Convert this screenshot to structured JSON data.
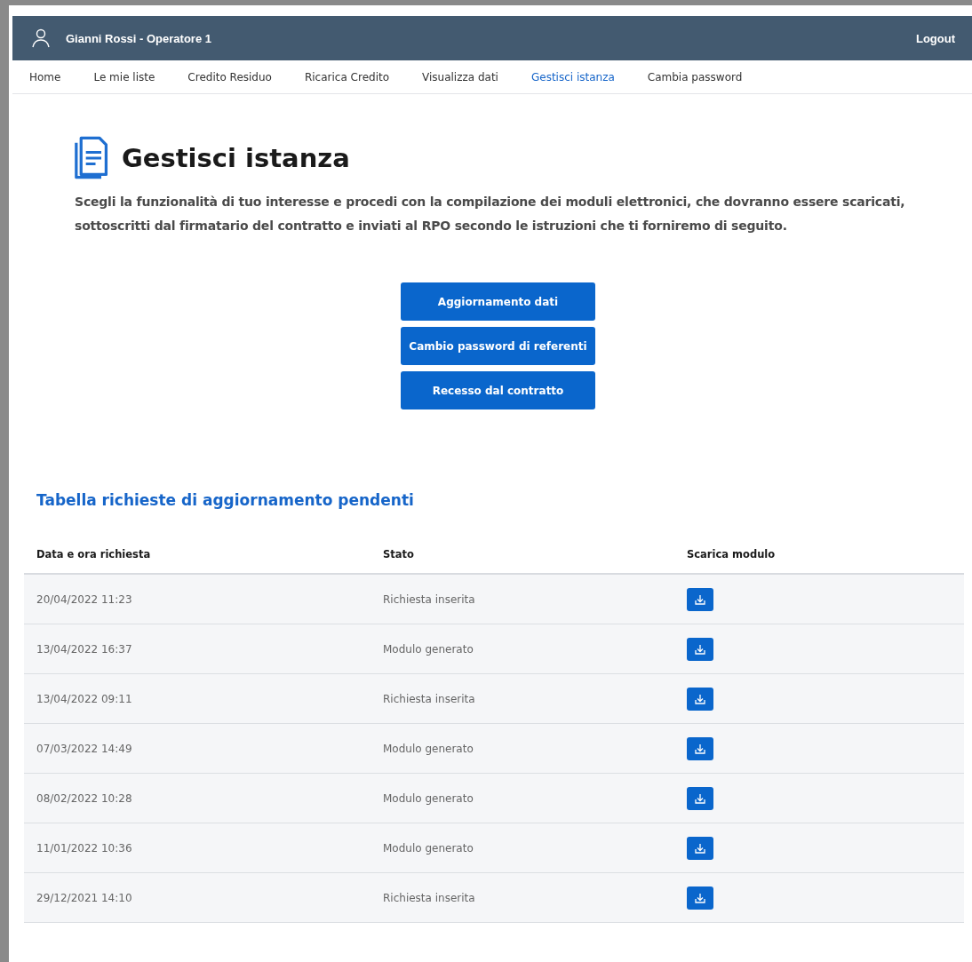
{
  "header": {
    "user": "Gianni Rossi - Operatore 1",
    "logout": "Logout"
  },
  "nav": [
    {
      "label": "Home",
      "selected": false
    },
    {
      "label": "Le mie liste",
      "selected": false
    },
    {
      "label": "Credito Residuo",
      "selected": false
    },
    {
      "label": "Ricarica Credito",
      "selected": false
    },
    {
      "label": "Visualizza dati",
      "selected": false
    },
    {
      "label": "Gestisci istanza",
      "selected": true
    },
    {
      "label": "Cambia password",
      "selected": false
    }
  ],
  "page": {
    "title": "Gestisci istanza",
    "intro": "Scegli la funzionalità di tuo interesse e procedi con la compilazione dei moduli elettronici, che dovranno essere scaricati, sottoscritti dal firmatario del contratto e inviati al RPO secondo le istruzioni che ti forniremo di seguito."
  },
  "actions": [
    "Aggiornamento dati",
    "Cambio password di referenti",
    "Recesso dal contratto"
  ],
  "table": {
    "title": "Tabella richieste di aggiornamento pendenti",
    "columns": [
      "Data e ora richiesta",
      "Stato",
      "Scarica modulo"
    ],
    "rows": [
      {
        "date": "20/04/2022 11:23",
        "status": "Richiesta inserita"
      },
      {
        "date": "13/04/2022 16:37",
        "status": "Modulo generato"
      },
      {
        "date": "13/04/2022 09:11",
        "status": "Richiesta inserita"
      },
      {
        "date": "07/03/2022 14:49",
        "status": "Modulo generato"
      },
      {
        "date": "08/02/2022 10:28",
        "status": "Modulo generato"
      },
      {
        "date": "11/01/2022 10:36",
        "status": "Modulo generato"
      },
      {
        "date": "29/12/2021 14:10",
        "status": "Richiesta inserita"
      }
    ]
  }
}
